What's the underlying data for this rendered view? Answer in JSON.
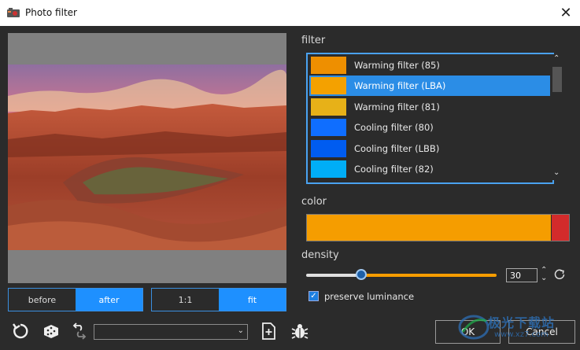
{
  "window": {
    "title": "Photo filter"
  },
  "preview": {
    "before_label": "before",
    "after_label": "after",
    "zoom_1_1_label": "1:1",
    "zoom_fit_label": "fit"
  },
  "filter": {
    "heading": "filter",
    "items": [
      {
        "label": "Warming filter (85)",
        "color": "#ee8f00",
        "selected": false
      },
      {
        "label": "Warming filter (LBA)",
        "color": "#f4a100",
        "selected": true
      },
      {
        "label": "Warming filter (81)",
        "color": "#e7b118",
        "selected": false
      },
      {
        "label": "Cooling filter (80)",
        "color": "#0f6eff",
        "selected": false
      },
      {
        "label": "Cooling filter (LBB)",
        "color": "#005cf0",
        "selected": false
      },
      {
        "label": "Cooling filter (82)",
        "color": "#00aef7",
        "selected": false
      }
    ]
  },
  "color": {
    "heading": "color",
    "value": "#f59d00"
  },
  "density": {
    "heading": "density",
    "value": "30",
    "slider_fraction": 0.3
  },
  "preserve_luminance": {
    "label": "preserve luminance",
    "checked": true
  },
  "buttons": {
    "ok": "OK",
    "cancel": "Cancel"
  },
  "preset": {
    "value": ""
  },
  "watermark": {
    "text": "极光下载站",
    "url": "www.xz7.com"
  }
}
